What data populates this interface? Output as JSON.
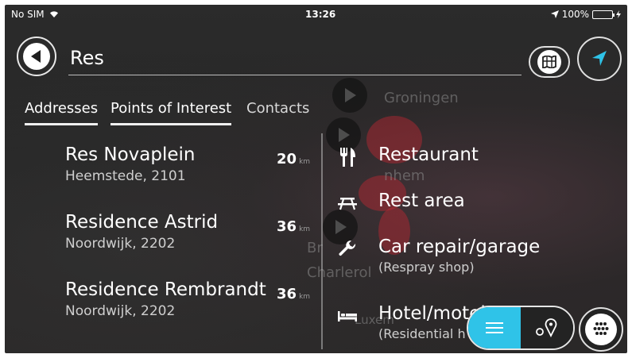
{
  "status_bar": {
    "carrier": "No SIM",
    "time": "13:26",
    "battery": "100%"
  },
  "search": {
    "value": "Res"
  },
  "tabs": [
    {
      "label": "Addresses",
      "active": true
    },
    {
      "label": "Points of Interest",
      "active": true
    },
    {
      "label": "Contacts",
      "active": false
    }
  ],
  "results": [
    {
      "name": "Res Novaplein",
      "place": "Heemstede, 2101",
      "distance": "20",
      "unit": "km"
    },
    {
      "name": "Residence Astrid",
      "place": "Noordwijk, 2202",
      "distance": "36",
      "unit": "km"
    },
    {
      "name": "Residence Rembrandt",
      "place": "Noordwijk, 2202",
      "distance": "36",
      "unit": "km"
    }
  ],
  "categories": [
    {
      "label": "Restaurant",
      "sub": "",
      "icon": "fork-knife-icon"
    },
    {
      "label": "Rest area",
      "sub": "",
      "icon": "picnic-table-icon"
    },
    {
      "label": "Car repair/garage",
      "sub": "(Respray shop)",
      "icon": "wrench-icon"
    },
    {
      "label": "Hotel/motel",
      "sub": "(Residential h",
      "icon": "bed-icon"
    }
  ],
  "map_labels": [
    "Groningen",
    "nhem",
    "Br",
    "Charlerol",
    "Luxem"
  ],
  "colors": {
    "accent": "#2fc3e8",
    "nav_arrow": "#2fc3e8",
    "battery": "#3ccf4a"
  }
}
